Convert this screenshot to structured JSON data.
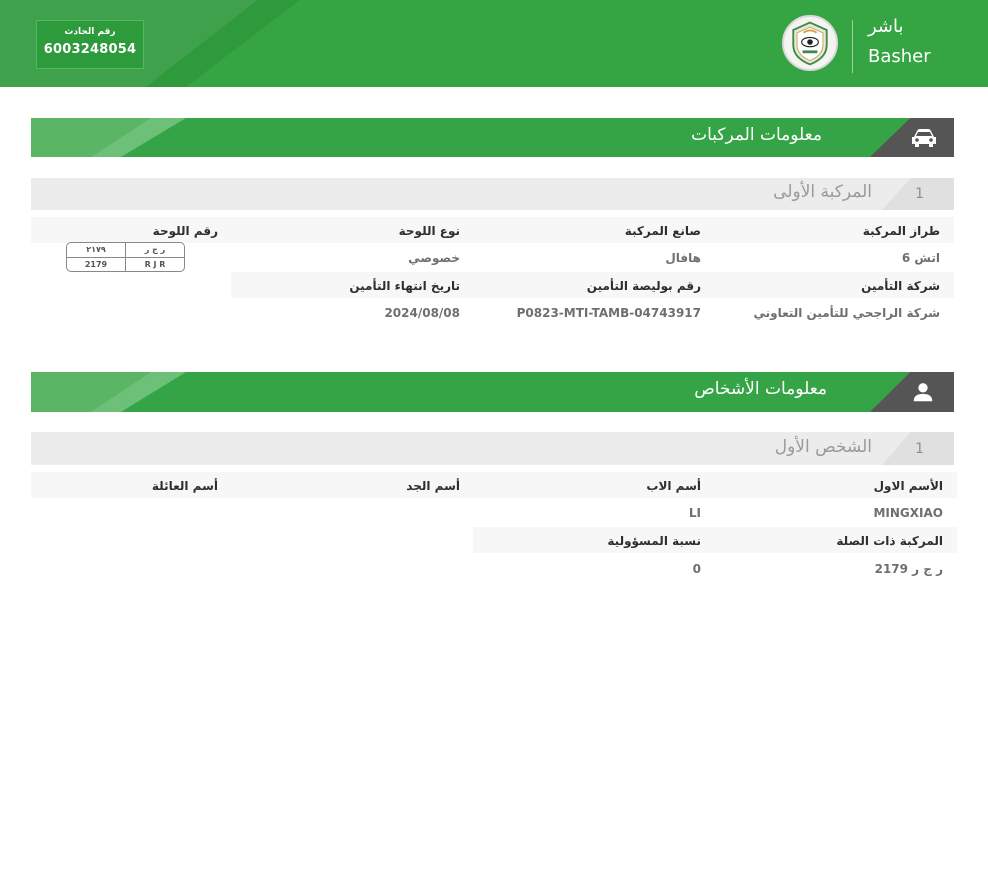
{
  "header": {
    "brand_ar": "باشر",
    "brand_en": "Basher",
    "accident_label": "رقم الحادث",
    "accident_number": "6003248054"
  },
  "vehicles_section": {
    "title": "معلومات المركبات",
    "icon": "car-icon",
    "vehicle": {
      "index": "1",
      "title": "المركبة الأولى",
      "labels": {
        "model": "طراز المركبة",
        "maker": "صانع المركبة",
        "plate_type": "نوع اللوحة",
        "plate_number": "رقم اللوحة",
        "insurer": "شركة التأمين",
        "policy_number": "رقم بوليصة التأمين",
        "insurance_expiry": "تاريخ انتهاء التأمين"
      },
      "values": {
        "model": "اتش 6",
        "maker": "هافال",
        "plate_type": "خصوصي",
        "insurer": "شركة الراجحي للتأمين التعاوني",
        "policy_number": "P0823-MTI-TAMB-04743917",
        "insurance_expiry": "2024/08/08"
      },
      "plate": {
        "letters_ar": "ر ج ر",
        "numbers_ar": "٢١٧٩",
        "letters_en": "R J R",
        "numbers_en": "2179"
      }
    }
  },
  "persons_section": {
    "title": "معلومات الأشخاص",
    "icon": "person-icon",
    "person": {
      "index": "1",
      "title": "الشخص الأول",
      "labels": {
        "first_name": "الأسم الاول",
        "father_name": "أسم الاب",
        "grandfather_name": "أسم الجد",
        "family_name": "أسم العائلة",
        "related_vehicle": "المركبة ذات الصلة",
        "liability": "نسبة المسؤولية"
      },
      "values": {
        "first_name": "MINGXIAO",
        "father_name": "LI",
        "related_vehicle": "ر ج ر 2179",
        "liability": "0"
      }
    }
  },
  "colors": {
    "primary_green": "#35a543",
    "dark_gray": "#555555",
    "light_gray": "#ececec"
  }
}
